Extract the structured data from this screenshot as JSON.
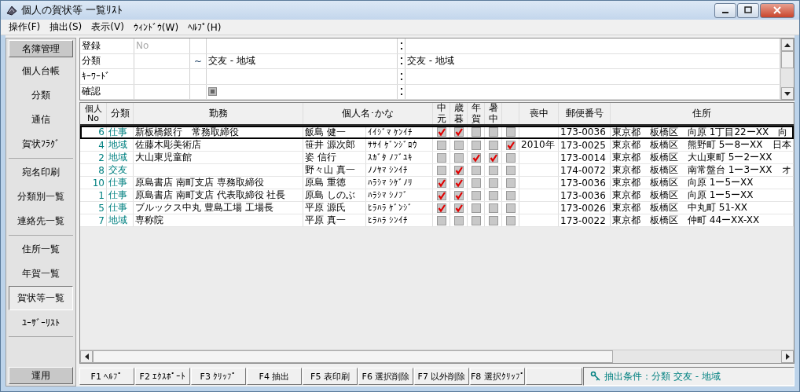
{
  "window": {
    "title": "個人の賀状等 一覧ﾘｽﾄ"
  },
  "menu": [
    "操作(F)",
    "抽出(S)",
    "表示(V)",
    "ｳｨﾝﾄﾞｳ(W)",
    "ﾍﾙﾌﾟ(H)"
  ],
  "sidebar": {
    "header": "名簿管理",
    "groups": [
      [
        {
          "label": "個人台帳",
          "selected": false
        },
        {
          "label": "分類",
          "selected": false
        },
        {
          "label": "通信",
          "selected": false
        },
        {
          "label": "賀状ﾌﾗｸﾞ",
          "selected": false
        }
      ],
      [
        {
          "label": "宛名印刷",
          "selected": false
        },
        {
          "label": "分類別一覧",
          "selected": false
        },
        {
          "label": "連絡先一覧",
          "selected": false
        }
      ],
      [
        {
          "label": "住所一覧",
          "selected": false
        },
        {
          "label": "年賀一覧",
          "selected": false
        },
        {
          "label": "賀状等一覧",
          "selected": true
        },
        {
          "label": "ﾕｰｻﾞｰﾘｽﾄ",
          "selected": false
        }
      ]
    ],
    "footer": "運用"
  },
  "filter": {
    "rows": [
      {
        "label": "登録",
        "column_2": "No",
        "column_3": "",
        "value": "",
        "value_2": ""
      },
      {
        "label": "分類",
        "column_2": "",
        "column_3": "~",
        "value": "交友 - 地域",
        "value_2": "交友 - 地域"
      },
      {
        "label": "ｷｰﾜｰﾄﾞ",
        "column_2": "",
        "column_3": "",
        "value": "",
        "value_2": ""
      },
      {
        "label": "確認",
        "column_2": "",
        "column_3": "",
        "value": "",
        "value_2": "",
        "has_checkbox": true
      }
    ]
  },
  "table": {
    "columns": [
      "個人No",
      "分類",
      "勤務",
      "個人名･かな",
      "中元",
      "歳暮",
      "年賀",
      "暑中",
      "喪中",
      "郵便番号",
      "住所"
    ],
    "rows": [
      {
        "selected": true,
        "no": "6",
        "category": "仕事",
        "work": "新板橋銀行　常務取締役",
        "name": "飯島 健一",
        "kana": "ｲｲｼﾞﾏ ｹﾝｲﾁ",
        "chugen": true,
        "seibo": true,
        "nenga": false,
        "shochu": false,
        "check_5": false,
        "mochu": "",
        "zip": "173-0036",
        "address": "東京都　板橋区　向原 1丁目22ーXX　向"
      },
      {
        "selected": false,
        "no": "4",
        "category": "地域",
        "work": "佐藤木彫美術店",
        "name": "笹井 源次郎",
        "kana": "ｻｻｲ ｹﾞﾝｼﾞﾛｳ",
        "chugen": false,
        "seibo": false,
        "nenga": false,
        "shochu": false,
        "check_5": true,
        "mochu": "2010年",
        "zip": "173-0025",
        "address": "東京都　板橋区　熊野町 5ー8ーXX　日本"
      },
      {
        "selected": false,
        "no": "2",
        "category": "地域",
        "work": "大山東児童館",
        "name": "姿 信行",
        "kana": "ｽｶﾞﾀ ﾉﾌﾞﾕｷ",
        "chugen": false,
        "seibo": false,
        "nenga": true,
        "shochu": true,
        "check_5": false,
        "mochu": "",
        "zip": "173-0014",
        "address": "東京都　板橋区　大山東町 5ー2ーXX"
      },
      {
        "selected": false,
        "no": "8",
        "category": "交友",
        "work": "",
        "name": "野々山 真一",
        "kana": "ﾉﾉﾔﾏ ｼﾝｲﾁ",
        "chugen": false,
        "seibo": true,
        "nenga": false,
        "shochu": false,
        "check_5": false,
        "mochu": "",
        "zip": "174-0072",
        "address": "東京都　板橋区　南常盤台 1ー3ーXX　オ"
      },
      {
        "selected": false,
        "no": "10",
        "category": "仕事",
        "work": "原島書店 南町支店 専務取締役",
        "name": "原島 重徳",
        "kana": "ﾊﾗｼﾏ ｼｹﾞﾉﾘ",
        "chugen": true,
        "seibo": true,
        "nenga": false,
        "shochu": false,
        "check_5": false,
        "mochu": "",
        "zip": "173-0036",
        "address": "東京都　板橋区　向原 1ー5ーXX"
      },
      {
        "selected": false,
        "no": "1",
        "category": "仕事",
        "work": "原島書店 南町支店 代表取締役 社長",
        "name": "原島 しのぶ",
        "kana": "ﾊﾗｼﾏ ｼﾉﾌﾞ",
        "chugen": true,
        "seibo": true,
        "nenga": false,
        "shochu": false,
        "check_5": false,
        "mochu": "",
        "zip": "173-0036",
        "address": "東京都　板橋区　向原 1ー5ーXX"
      },
      {
        "selected": false,
        "no": "5",
        "category": "仕事",
        "work": "ブルックス中丸 豊島工場 工場長",
        "name": "平原 源氏",
        "kana": "ﾋﾗﾊﾗ ｹﾞﾝｼﾞ",
        "chugen": true,
        "seibo": true,
        "nenga": false,
        "shochu": false,
        "check_5": false,
        "mochu": "",
        "zip": "173-0026",
        "address": "東京都　板橋区　中丸町 51-XX"
      },
      {
        "selected": false,
        "no": "7",
        "category": "地域",
        "work": "専称院",
        "name": "平原 真一",
        "kana": "ﾋﾗﾊﾗ ｼﾝｲﾁ",
        "chugen": false,
        "seibo": false,
        "nenga": false,
        "shochu": false,
        "check_5": false,
        "mochu": "",
        "zip": "173-0022",
        "address": "東京都　板橋区　仲町 44ーXX-XX"
      }
    ]
  },
  "function_keys": [
    "F1 ﾍﾙﾌﾟ",
    "F2 ｴｸｽﾎﾟｰﾄ",
    "F3 ｸﾘｯﾌﾟ",
    "F4 抽出",
    "F5 表印刷",
    "F6 選択削除",
    "F7 以外削除",
    "F8 選択ｸﾘｯﾌﾟ"
  ],
  "status_bar": {
    "text": "抽出条件：分類 交友 - 地域"
  }
}
